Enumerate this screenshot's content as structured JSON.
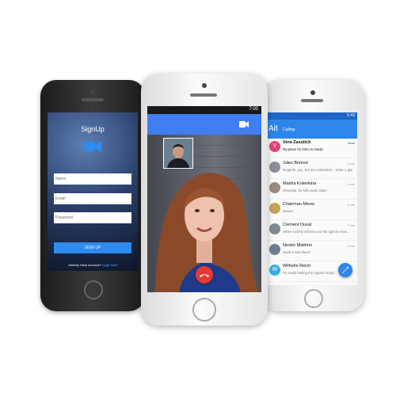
{
  "signup_phone": {
    "title": "SignUp",
    "name_placeholder": "Name",
    "email_placeholder": "Email",
    "password_placeholder": "Password",
    "signup_button": "SIGN UP",
    "account_prompt": "Already Have Account?",
    "login_link": "Login Now",
    "logo_icon": "video-camera-icon"
  },
  "call_phone": {
    "status_time": "7:00",
    "toolbar_icon": "video-camera-icon",
    "end_call_icon": "phone-hangup-icon",
    "colors": {
      "toolbar": "#3f7ff2",
      "end_call": "#e73a36"
    }
  },
  "chat_phone": {
    "status_time": "5:43",
    "app_title": "Ait",
    "app_subtitle": "Calling",
    "fab_icon": "pencil-icon",
    "chats": [
      {
        "name": "Vera Zasulich",
        "message": "My place for lokrs is ready!",
        "time": "Now",
        "avatar_letter": "V",
        "avatar_color": "#e4407b"
      },
      {
        "name": "Jules Bonnot",
        "message": "Regards, yes, but you remember... enter x glorious",
        "time": "2 min",
        "avatar_letter": "",
        "avatar_color": "#8a8f98"
      },
      {
        "name": "Masha Kolenkina",
        "message": "Revenge, for kills away sake!",
        "time": "2 min",
        "avatar_letter": "",
        "avatar_color": "#9a8a7a"
      },
      {
        "name": "Chairman Meow",
        "message": "Meow!",
        "time": "4 min",
        "avatar_letter": "",
        "avatar_color": "#c9a15a"
      },
      {
        "name": "Clement Duval",
        "message": "When society refuses you the right to exist...",
        "time": "7 min",
        "avatar_letter": "",
        "avatar_color": "#7f8c8d"
      },
      {
        "name": "Nestor Makhno",
        "message": "Need a ride there?",
        "time": "3 min",
        "avatar_letter": "",
        "avatar_color": "#6f7f8f"
      },
      {
        "name": "Wilhelm Reich",
        "message": "I'm really feeling the orgone today!",
        "time": "",
        "avatar_letter": "W",
        "avatar_color": "#36b0d8"
      }
    ],
    "colors": {
      "appbar": "#2f86ea",
      "statusbar": "#1e66c8"
    }
  }
}
